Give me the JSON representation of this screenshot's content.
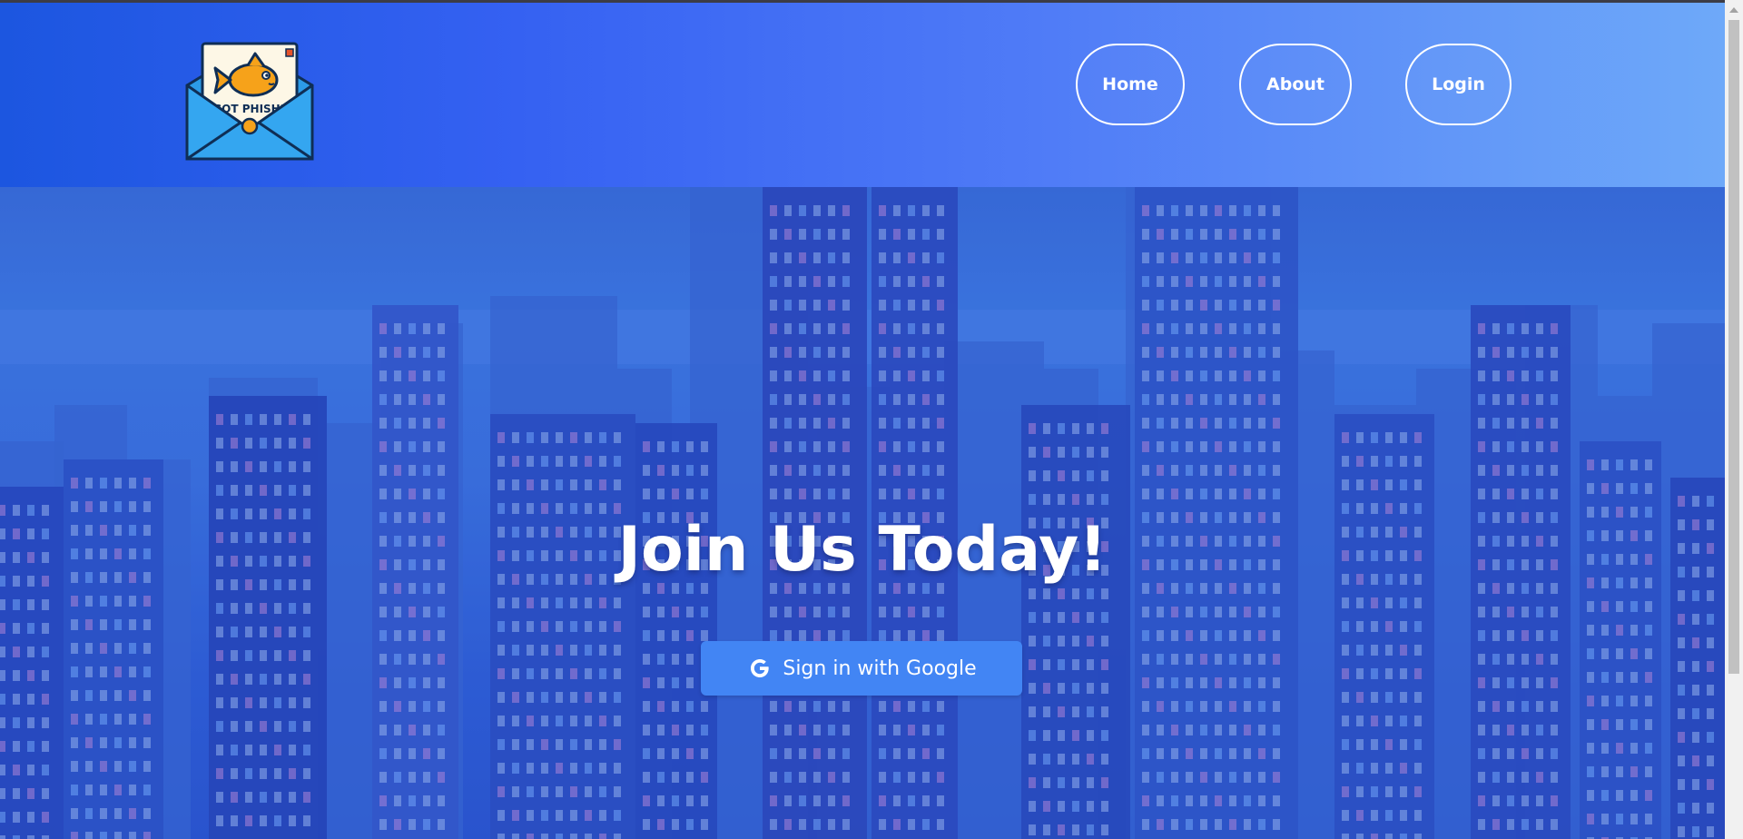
{
  "header": {
    "logo": {
      "text": "GOT PHISH?",
      "icon": "fish-envelope-logo"
    },
    "nav": [
      {
        "label": "Home"
      },
      {
        "label": "About"
      },
      {
        "label": "Login"
      }
    ]
  },
  "hero": {
    "title": "Join Us Today!",
    "google_button": {
      "label": "Sign in with Google",
      "icon": "google-g-icon"
    }
  },
  "colors": {
    "header_gradient_start": "#1c56e0",
    "header_gradient_end": "#6ea9f9",
    "google_button": "#4285f4",
    "text": "#ffffff"
  }
}
